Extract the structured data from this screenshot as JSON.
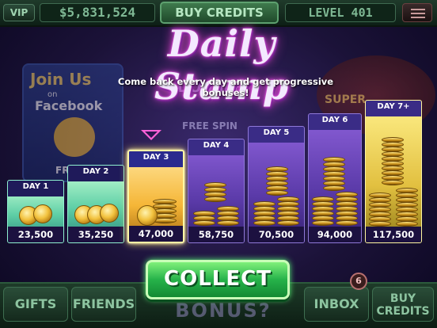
{
  "top_bar": {
    "vip_label": "VIP",
    "credits": "$5,831,524",
    "buy_credits_label": "BUY CREDITS",
    "level": "LEVEL 401"
  },
  "background": {
    "promo_title": "Join Us",
    "promo_on": "on",
    "promo_site": "Facebook",
    "promo_bottom": "FREE",
    "double_text": "DOUBLE",
    "free_spin_text": "FREE SPIN",
    "super_text": "SUPER"
  },
  "dialog": {
    "title": "Daily Stamp",
    "subtitle": "Come back every day and get progressive bonuses!",
    "collect_label": "COLLECT"
  },
  "days": [
    {
      "label": "DAY 1",
      "amount": "23,500",
      "state": "collected"
    },
    {
      "label": "DAY 2",
      "amount": "35,250",
      "state": "collected"
    },
    {
      "label": "DAY 3",
      "amount": "47,000",
      "state": "today"
    },
    {
      "label": "DAY 4",
      "amount": "58,750",
      "state": "upcoming"
    },
    {
      "label": "DAY 5",
      "amount": "70,500",
      "state": "upcoming"
    },
    {
      "label": "DAY 6",
      "amount": "94,000",
      "state": "upcoming"
    },
    {
      "label": "DAY 7+",
      "amount": "117,500",
      "state": "upcoming"
    }
  ],
  "bottom_bar": {
    "gifts_label": "GIFTS",
    "friends_label": "FRIENDS",
    "bonus_label": "BONUS?",
    "inbox_label": "INBOX",
    "inbox_count": "6",
    "buy_credits_line1": "BUY",
    "buy_credits_line2": "CREDITS"
  },
  "colors": {
    "accent_title_glow": "#ff4fd8",
    "collect_green": "#26b24a",
    "today_highlight": "#ffe873"
  }
}
